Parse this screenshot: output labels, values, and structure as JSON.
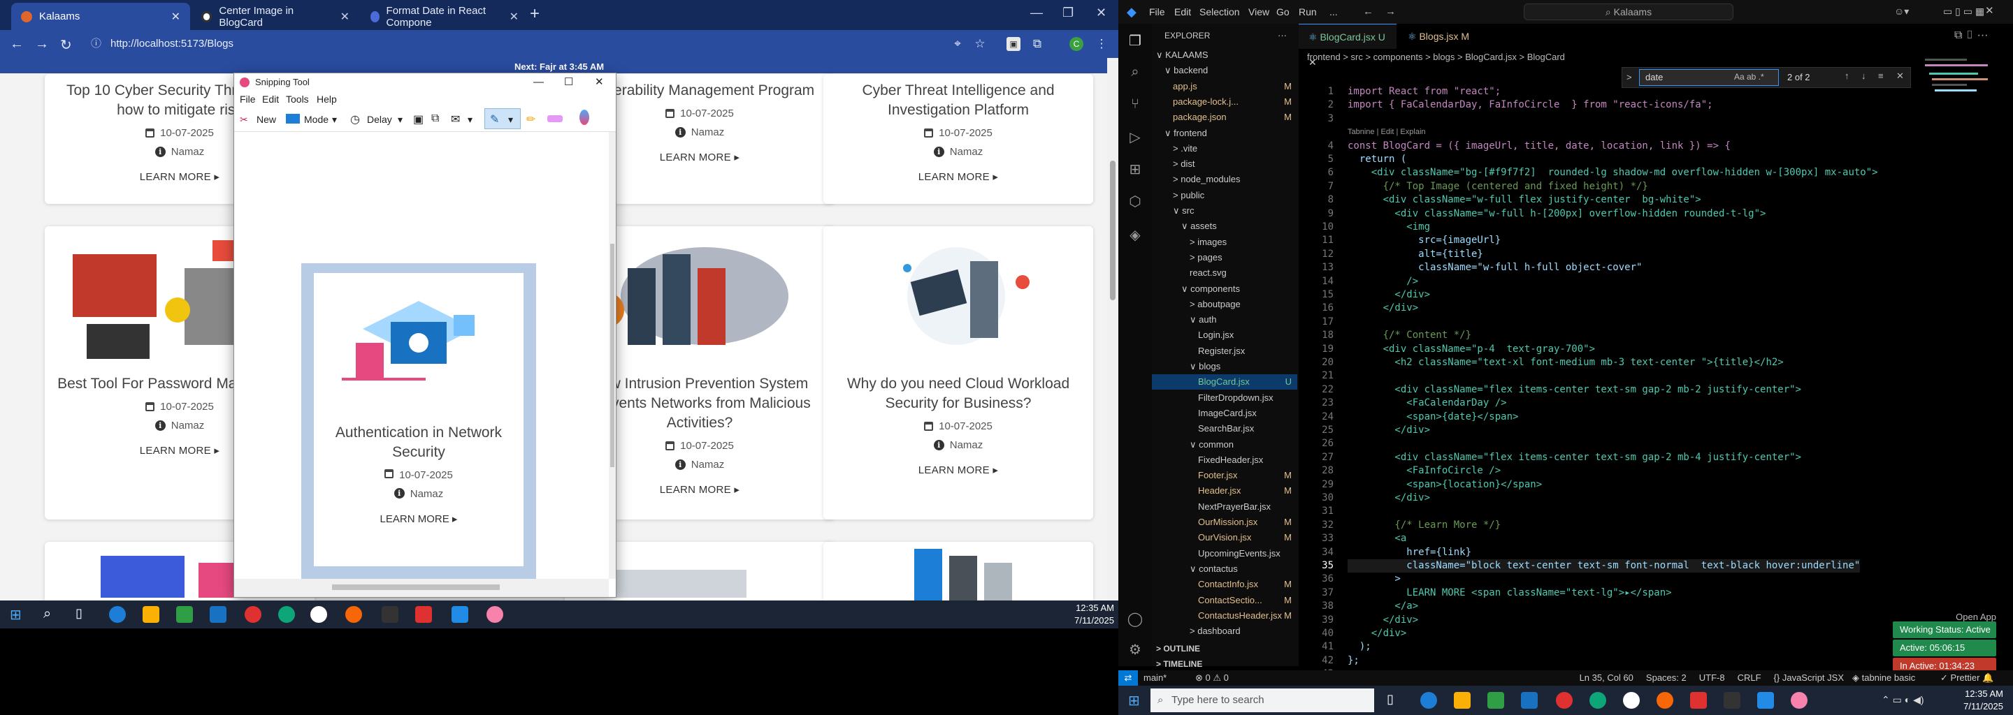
{
  "browser": {
    "tabs": [
      {
        "title": "Kalaams",
        "active": true
      },
      {
        "title": "Center Image in BlogCard",
        "active": false
      },
      {
        "title": "Format Date in React Compone",
        "active": false
      }
    ],
    "url": "http://localhost:5173/Blogs",
    "ticker": "Next: Fajr at 3:45 AM"
  },
  "blog_cards": [
    {
      "title": "Top 10 Cyber Security Threats and how to mitigate risk",
      "date": "10-07-2025",
      "author": "Namaz",
      "more": "LEARN MORE ▸"
    },
    {
      "title": "Vulnerability Management Program",
      "date": "10-07-2025",
      "author": "Namaz",
      "more": "LEARN MORE ▸"
    },
    {
      "title": "Cyber Threat Intelligence and Investigation Platform",
      "date": "10-07-2025",
      "author": "Namaz",
      "more": "LEARN MORE ▸"
    },
    {
      "title": "Best Tool For Password Management",
      "date": "10-07-2025",
      "author": "Namaz",
      "more": "LEARN MORE ▸"
    },
    {
      "title": "How Intrusion Prevention System Prevents Networks from Malicious Activities?",
      "date": "10-07-2025",
      "author": "Namaz",
      "more": "LEARN MORE ▸"
    },
    {
      "title": "Why do you need Cloud Workload Security for Business?",
      "date": "10-07-2025",
      "author": "Namaz",
      "more": "LEARN MORE ▸"
    }
  ],
  "snipping_tool": {
    "title": "Snipping Tool",
    "menu": [
      "File",
      "Edit",
      "Tools",
      "Help"
    ],
    "toolbar": {
      "new": "New",
      "mode": "Mode",
      "delay": "Delay"
    },
    "card": {
      "title": "Authentication in Network Security",
      "date": "10-07-2025",
      "author": "Namaz",
      "more": "LEARN MORE ▸"
    }
  },
  "taskbar_left": {
    "time": "12:35 AM",
    "date": "7/11/2025"
  },
  "vscode": {
    "menu": [
      "File",
      "Edit",
      "Selection",
      "View",
      "Go",
      "Run",
      "..."
    ],
    "search": "Kalaams",
    "explorer_title": "EXPLORER",
    "tree": [
      {
        "name": "KALAAMS",
        "indent": 0,
        "caret": "∨",
        "flag": ""
      },
      {
        "name": "backend",
        "indent": 1,
        "caret": "∨",
        "flag": ""
      },
      {
        "name": "app.js",
        "indent": 2,
        "caret": "",
        "flag": "M"
      },
      {
        "name": "package-lock.j...",
        "indent": 2,
        "caret": "",
        "flag": "M"
      },
      {
        "name": "package.json",
        "indent": 2,
        "caret": "",
        "flag": "M"
      },
      {
        "name": "frontend",
        "indent": 1,
        "caret": "∨",
        "flag": ""
      },
      {
        "name": ".vite",
        "indent": 2,
        "caret": ">",
        "flag": ""
      },
      {
        "name": "dist",
        "indent": 2,
        "caret": ">",
        "flag": ""
      },
      {
        "name": "node_modules",
        "indent": 2,
        "caret": ">",
        "flag": ""
      },
      {
        "name": "public",
        "indent": 2,
        "caret": ">",
        "flag": ""
      },
      {
        "name": "src",
        "indent": 2,
        "caret": "∨",
        "flag": ""
      },
      {
        "name": "assets",
        "indent": 3,
        "caret": "∨",
        "flag": ""
      },
      {
        "name": "images",
        "indent": 4,
        "caret": ">",
        "flag": ""
      },
      {
        "name": "pages",
        "indent": 4,
        "caret": ">",
        "flag": ""
      },
      {
        "name": "react.svg",
        "indent": 4,
        "caret": "",
        "flag": ""
      },
      {
        "name": "components",
        "indent": 3,
        "caret": "∨",
        "flag": ""
      },
      {
        "name": "aboutpage",
        "indent": 4,
        "caret": ">",
        "flag": ""
      },
      {
        "name": "auth",
        "indent": 4,
        "caret": "∨",
        "flag": ""
      },
      {
        "name": "Login.jsx",
        "indent": 5,
        "caret": "",
        "flag": ""
      },
      {
        "name": "Register.jsx",
        "indent": 5,
        "caret": "",
        "flag": ""
      },
      {
        "name": "blogs",
        "indent": 4,
        "caret": "∨",
        "flag": ""
      },
      {
        "name": "BlogCard.jsx",
        "indent": 5,
        "caret": "",
        "flag": "U"
      },
      {
        "name": "FilterDropdown.jsx",
        "indent": 5,
        "caret": "",
        "flag": ""
      },
      {
        "name": "ImageCard.jsx",
        "indent": 5,
        "caret": "",
        "flag": ""
      },
      {
        "name": "SearchBar.jsx",
        "indent": 5,
        "caret": "",
        "flag": ""
      },
      {
        "name": "common",
        "indent": 4,
        "caret": "∨",
        "flag": ""
      },
      {
        "name": "FixedHeader.jsx",
        "indent": 5,
        "caret": "",
        "flag": ""
      },
      {
        "name": "Footer.jsx",
        "indent": 5,
        "caret": "",
        "flag": "M"
      },
      {
        "name": "Header.jsx",
        "indent": 5,
        "caret": "",
        "flag": "M"
      },
      {
        "name": "NextPrayerBar.jsx",
        "indent": 5,
        "caret": "",
        "flag": ""
      },
      {
        "name": "OurMission.jsx",
        "indent": 5,
        "caret": "",
        "flag": "M"
      },
      {
        "name": "OurVision.jsx",
        "indent": 5,
        "caret": "",
        "flag": "M"
      },
      {
        "name": "UpcomingEvents.jsx",
        "indent": 5,
        "caret": "",
        "flag": ""
      },
      {
        "name": "contactus",
        "indent": 4,
        "caret": "∨",
        "flag": ""
      },
      {
        "name": "ContactInfo.jsx",
        "indent": 5,
        "caret": "",
        "flag": "M"
      },
      {
        "name": "ContactSectio...",
        "indent": 5,
        "caret": "",
        "flag": "M"
      },
      {
        "name": "ContactusHeader.jsx",
        "indent": 5,
        "caret": "",
        "flag": "M"
      },
      {
        "name": "dashboard",
        "indent": 4,
        "caret": ">",
        "flag": ""
      }
    ],
    "outline": "OUTLINE",
    "timeline": "TIMELINE",
    "tabs": [
      {
        "name": "BlogCard.jsx",
        "flag": "U",
        "active": true
      },
      {
        "name": "Blogs.jsx",
        "flag": "M",
        "active": false
      }
    ],
    "breadcrumb": "frontend > src > components > blogs > BlogCard.jsx > BlogCard",
    "find": {
      "query": "date",
      "result": "2 of 2"
    },
    "code_lines": [
      {
        "n": "1",
        "t": "import React from \"react\";"
      },
      {
        "n": "2",
        "t": "import { FaCalendarDay, FaInfoCircle  } from \"react-icons/fa\";"
      },
      {
        "n": "3",
        "t": ""
      },
      {
        "n": "",
        "t": "Tabnine | Edit | Explain"
      },
      {
        "n": "4",
        "t": "const BlogCard = ({ imageUrl, title, date, location, link }) => {"
      },
      {
        "n": "5",
        "t": "  return ("
      },
      {
        "n": "6",
        "t": "    <div className=\"bg-[#f9f7f2]  rounded-lg shadow-md overflow-hidden w-[300px] mx-auto\">"
      },
      {
        "n": "7",
        "t": "      {/* Top Image (centered and fixed height) */}"
      },
      {
        "n": "8",
        "t": "      <div className=\"w-full flex justify-center  bg-white\">"
      },
      {
        "n": "9",
        "t": "        <div className=\"w-full h-[200px] overflow-hidden rounded-t-lg\">"
      },
      {
        "n": "10",
        "t": "          <img"
      },
      {
        "n": "11",
        "t": "            src={imageUrl}"
      },
      {
        "n": "12",
        "t": "            alt={title}"
      },
      {
        "n": "13",
        "t": "            className=\"w-full h-full object-cover\""
      },
      {
        "n": "14",
        "t": "          />"
      },
      {
        "n": "15",
        "t": "        </div>"
      },
      {
        "n": "16",
        "t": "      </div>"
      },
      {
        "n": "17",
        "t": ""
      },
      {
        "n": "18",
        "t": "      {/* Content */}"
      },
      {
        "n": "19",
        "t": "      <div className=\"p-4  text-gray-700\">"
      },
      {
        "n": "20",
        "t": "        <h2 className=\"text-xl font-medium mb-3 text-center \">{title}</h2>"
      },
      {
        "n": "21",
        "t": ""
      },
      {
        "n": "22",
        "t": "        <div className=\"flex items-center text-sm gap-2 mb-2 justify-center\">"
      },
      {
        "n": "23",
        "t": "          <FaCalendarDay />"
      },
      {
        "n": "24",
        "t": "          <span>{date}</span>"
      },
      {
        "n": "25",
        "t": "        </div>"
      },
      {
        "n": "26",
        "t": ""
      },
      {
        "n": "27",
        "t": "        <div className=\"flex items-center text-sm gap-2 mb-4 justify-center\">"
      },
      {
        "n": "28",
        "t": "          <FaInfoCircle />"
      },
      {
        "n": "29",
        "t": "          <span>{location}</span>"
      },
      {
        "n": "30",
        "t": "        </div>"
      },
      {
        "n": "31",
        "t": ""
      },
      {
        "n": "32",
        "t": "        {/* Learn More */}"
      },
      {
        "n": "33",
        "t": "        <a"
      },
      {
        "n": "34",
        "t": "          href={link}"
      },
      {
        "n": "35",
        "t": "          className=\"block text-center text-sm font-normal  text-black hover:underline\""
      },
      {
        "n": "36",
        "t": "        >"
      },
      {
        "n": "37",
        "t": "          LEARN MORE <span className=\"text-lg\">▸</span>"
      },
      {
        "n": "38",
        "t": "        </a>"
      },
      {
        "n": "39",
        "t": "      </div>"
      },
      {
        "n": "40",
        "t": "    </div>"
      },
      {
        "n": "41",
        "t": "  );"
      },
      {
        "n": "42",
        "t": "};"
      },
      {
        "n": "43",
        "t": ""
      }
    ],
    "status": {
      "branch": "main*",
      "errors": "⊗ 0 ⚠ 0",
      "position": "Ln 35, Col 60",
      "spaces": "Spaces: 2",
      "encoding": "UTF-8",
      "eol": "CRLF",
      "language": "{} JavaScript JSX",
      "tabnine": "tabnine basic",
      "prettier": "Prettier"
    },
    "notifications": {
      "open_app": "Open App",
      "working": "Working Status: Active",
      "active": "Active: 05:06:15",
      "inactive": "In Active: 01:34:23"
    }
  },
  "taskbar_right": {
    "search_placeholder": "Type here to search",
    "time": "12:35 AM",
    "date": "7/11/2025"
  },
  "colors": {
    "browser_tab": "#142a5a",
    "browser_bar": "#2a4c9e",
    "vs_sel": "#0b3a6b",
    "notif_green": "#1f8a4c",
    "notif_red": "#c0392b"
  }
}
